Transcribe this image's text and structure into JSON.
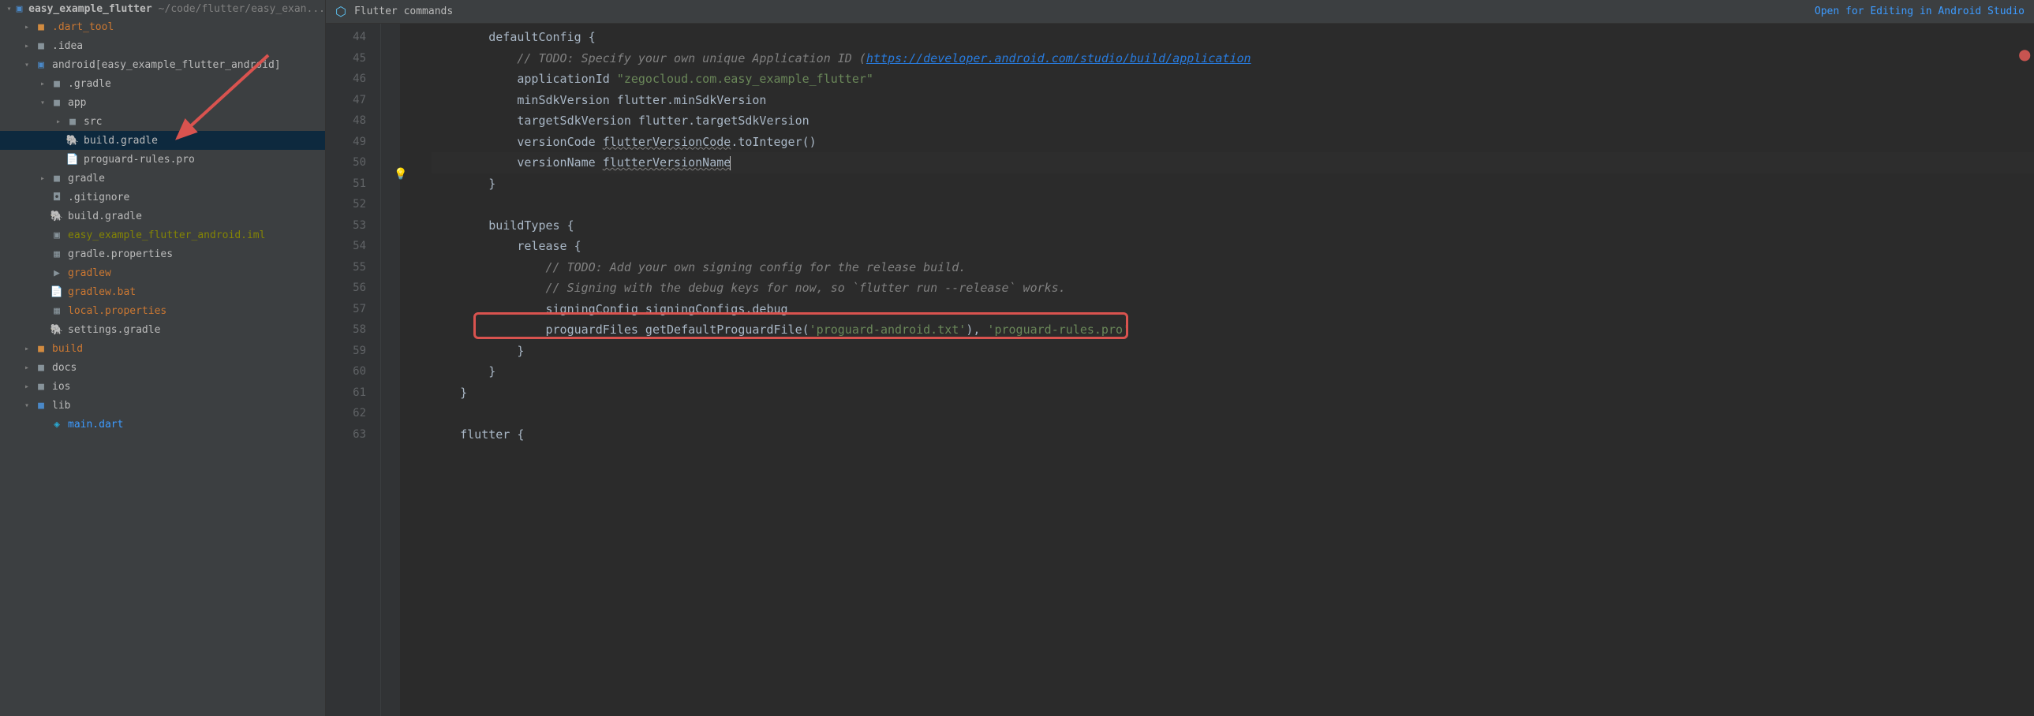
{
  "project": {
    "name": "easy_example_flutter",
    "path": "~/code/flutter/easy_exan..."
  },
  "toolbar": {
    "title": "Flutter commands",
    "open_link": "Open for Editing in Android Studio"
  },
  "tree": {
    "dart_tool": ".dart_tool",
    "idea": ".idea",
    "android": "android",
    "android_suffix": " [easy_example_flutter_android]",
    "dot_gradle": ".gradle",
    "app": "app",
    "src": "src",
    "build_gradle_app": "build.gradle",
    "proguard": "proguard-rules.pro",
    "gradle_folder": "gradle",
    "gitignore": ".gitignore",
    "build_gradle": "build.gradle",
    "iml": "easy_example_flutter_android.iml",
    "gradle_properties": "gradle.properties",
    "gradlew": "gradlew",
    "gradlew_bat": "gradlew.bat",
    "local_properties": "local.properties",
    "settings_gradle": "settings.gradle",
    "build": "build",
    "docs": "docs",
    "ios": "ios",
    "lib": "lib",
    "main_dart": "main.dart"
  },
  "gutter": {
    "l44": "44",
    "l45": "45",
    "l46": "46",
    "l47": "47",
    "l48": "48",
    "l49": "49",
    "l50": "50",
    "l51": "51",
    "l52": "52",
    "l53": "53",
    "l54": "54",
    "l55": "55",
    "l56": "56",
    "l57": "57",
    "l58": "58",
    "l59": "59",
    "l60": "60",
    "l61": "61",
    "l62": "62",
    "l63": "63"
  },
  "code": {
    "l44_a": "        defaultConfig ",
    "l44_b": "{",
    "l45_a": "            ",
    "l45_b": "// TODO: Specify your own unique Application ID (",
    "l45_c": "https://developer.android.com/studio/build/application",
    "l46_a": "            applicationId ",
    "l46_b": "\"zegocloud.com.easy_example_flutter\"",
    "l47_a": "            minSdkVersion flutter.minSdkVersion",
    "l48_a": "            targetSdkVersion flutter.targetSdkVersion",
    "l49_a": "            versionCode ",
    "l49_b": "flutterVersionCode",
    "l49_c": ".toInteger()",
    "l50_a": "            versionName ",
    "l50_b": "flutterVersionName",
    "l51_a": "        ",
    "l51_b": "}",
    "l53_a": "        buildTypes ",
    "l53_b": "{",
    "l54_a": "            release ",
    "l54_b": "{",
    "l55_a": "                ",
    "l55_b": "// TODO: Add your own signing config for the release build.",
    "l56_a": "                ",
    "l56_b": "// Signing with the debug keys for now, so `flutter run --release` works.",
    "l57_a": "                signingConfig signingConfigs.debug",
    "l58_a": "                proguardFiles getDefaultProguardFile(",
    "l58_b": "'proguard-android.txt'",
    "l58_c": "), ",
    "l58_d": "'proguard-rules.pro'",
    "l59_a": "            ",
    "l59_b": "}",
    "l60_a": "        ",
    "l60_b": "}",
    "l61_a": "    ",
    "l61_b": "}",
    "l63_a": "    flutter ",
    "l63_b": "{"
  }
}
